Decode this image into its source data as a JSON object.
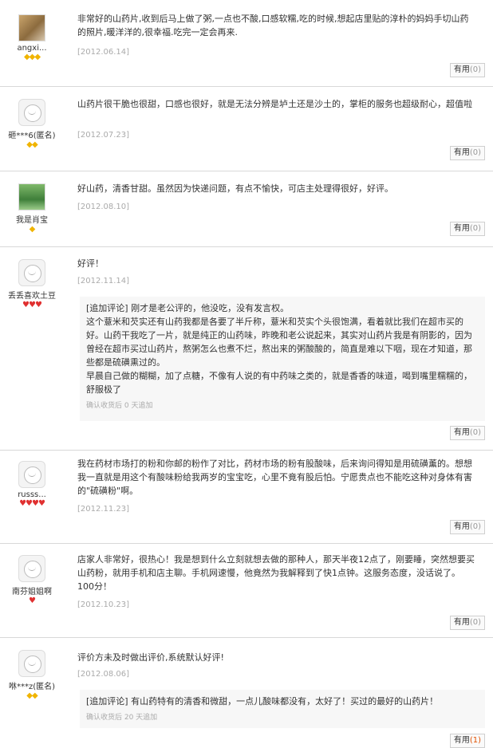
{
  "reviews": [
    {
      "username": "angxi...",
      "rank": "◆◆◆",
      "text": "非常好的山药片,收到后马上做了粥,一点也不酸,口感软糯,吃的时候,想起店里贴的淳朴的妈妈手切山药的照片,暖洋洋的,很幸福.吃完一定会再来.",
      "date": "[2012.06.14]",
      "useful_label": "有用",
      "useful_count": "(0)"
    },
    {
      "username": "砸***6(匿名)",
      "rank": "◆◆",
      "text": "山药片很干脆也很甜，口感也很好，就是无法分辨是垆土还是沙土的，掌柜的服务也超级耐心，超值啦",
      "date": "[2012.07.23]",
      "useful_label": "有用",
      "useful_count": "(0)"
    },
    {
      "username": "我是肖宝",
      "rank": "◆",
      "text": "好山药，清香甘甜。虽然因为快递问题，有点不愉快，可店主处理得很好，好评。",
      "date": "[2012.08.10]",
      "useful_label": "有用",
      "useful_count": "(0)"
    },
    {
      "username": "丢丢喜欢土豆",
      "rank": "♥♥♥",
      "text": "好评！",
      "date": "[2012.11.14]",
      "append": {
        "text": "[追加评论] 刚才是老公评的，他没吃，没有发言权。\n这个薏米和芡实还有山药我都是各要了半斤称，薏米和芡实个头很饱满，看着就比我们在超市买的好。山药干我吃了一片，就是纯正的山药味，昨晚和老公说起来，其实对山药片我是有阴影的，因为曾经在超市买过山药片，熬粥怎么也煮不烂，熬出来的粥酸酸的，简直是难以下咽，现在才知道，那些都是硫磺熏过的。\n早晨自己做的糊糊，加了点糖，不像有人说的有中药味之类的，就是香香的味道，喝到嘴里糯糯的，舒服极了",
        "note": "确认收货后 0 天追加"
      },
      "useful_label": "有用",
      "useful_count": "(0)"
    },
    {
      "username": "russs...",
      "rank": "♥♥♥♥",
      "text": "我在药材市场打的粉和你邮的粉作了对比，药材市场的粉有股酸味，后来询问得知是用硫磺薰的。想想我一直就是用这个有酸味粉给我两岁的宝宝吃，心里不竟有股后怕。宁愿贵点也不能吃这种对身体有害的\"硫磺粉\"啊。",
      "date": "[2012.11.23]",
      "useful_label": "有用",
      "useful_count": "(0)"
    },
    {
      "username": "南芬姐姐啊",
      "rank": "♥",
      "text": "店家人非常好，很热心！我是想到什么立刻就想去做的那种人，那天半夜12点了，刚要睡，突然想要买山药粉，就用手机和店主聊。手机网速慢，他竟然为我解释到了快1点钟。这服务态度，没话说了。100分！",
      "date": "[2012.10.23]",
      "useful_label": "有用",
      "useful_count": "(0)"
    },
    {
      "username": "咻***z(匿名)",
      "rank": "◆◆",
      "text": "评价方未及时做出评价,系统默认好评!",
      "date": "[2012.08.06]",
      "append": {
        "text": "[追加评论] 有山药特有的清香和微甜，一点儿酸味都没有，太好了！买过的最好的山药片！",
        "note": "确认收货后 20 天追加"
      },
      "useful_label": "有用",
      "useful_count": "(1)"
    }
  ]
}
